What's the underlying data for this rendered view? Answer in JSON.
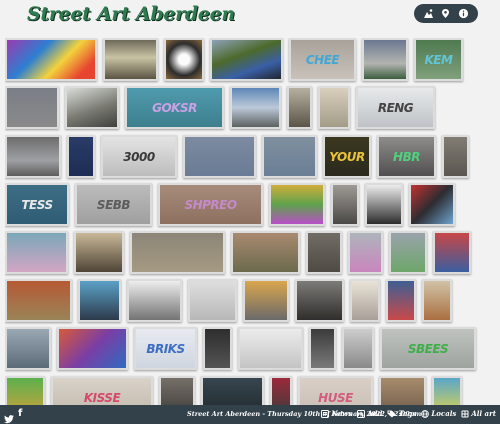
{
  "header": {
    "title": "Street Art Aberdeen"
  },
  "toolbar": [
    {
      "name": "gallery-view-icon",
      "label": ""
    },
    {
      "name": "map-pin-icon",
      "label": ""
    },
    {
      "name": "info-icon",
      "label": ""
    }
  ],
  "colors": {
    "title": "#2f7a4e",
    "bar": "#33414a",
    "background": "#f2f2f2"
  },
  "gallery": {
    "rows": [
      {
        "thumbs": [
          {
            "w": 92,
            "bg": "linear-gradient(135deg,#9c3bb0,#2d7fd1 35%,#f3d23d 60%,#e7452f 85%)",
            "text": "",
            "tc": "#fff"
          },
          {
            "w": 55,
            "bg": "linear-gradient(180deg,#6d6a5a,#c9c3a4 45%,#5b5443)",
            "text": "",
            "tc": "#fff"
          },
          {
            "w": 40,
            "bg": "radial-gradient(circle at 50% 50%,#fbfbfb 20%,#2c2c2c 60%,#8b6a3e)",
            "text": "",
            "tc": "#222"
          },
          {
            "w": 73,
            "bg": "linear-gradient(160deg,#8da3b8,#4d6a2c 40%,#3a5fa6 70%,#20262d)",
            "text": "",
            "tc": "#fff"
          },
          {
            "w": 67,
            "bg": "linear-gradient(180deg,#a8a29b,#c8c2ba)",
            "text": "CHEE",
            "tc": "#43a7d4"
          },
          {
            "w": 46,
            "bg": "linear-gradient(180deg,#6b7890,#b3b4b0 60%,#3c5f3f)",
            "text": "",
            "tc": "#fff"
          },
          {
            "w": 49,
            "bg": "linear-gradient(180deg,#4f7a50,#7fa07b)",
            "text": "KEM",
            "tc": "#62c5d5"
          }
        ]
      },
      {
        "thumbs": [
          {
            "w": 54,
            "bg": "linear-gradient(180deg,#7a7e86,#8a8a8a)",
            "text": "",
            "tc": "#78b6e6"
          },
          {
            "w": 54,
            "bg": "linear-gradient(160deg,#d9ddd8,#7b7b74 55%,#3f3f3d)",
            "text": "",
            "tc": "#fff"
          },
          {
            "w": 99,
            "bg": "linear-gradient(180deg,#4f9bae,#3d7f8e)",
            "text": "GOKSR",
            "tc": "#c8a2e4"
          },
          {
            "w": 51,
            "bg": "linear-gradient(180deg,#5d86b7,#bcc9d8 50%,#5d6161)",
            "text": "",
            "tc": "#fff"
          },
          {
            "w": 25,
            "bg": "linear-gradient(180deg,#b6b09f,#5b5549)",
            "text": "",
            "tc": "#fff"
          },
          {
            "w": 32,
            "bg": "linear-gradient(180deg,#d8d0bd,#a39c88)",
            "text": "",
            "tc": "#333"
          },
          {
            "w": 79,
            "bg": "linear-gradient(180deg,#e7e9ea,#bfc3c7)",
            "text": "RENG",
            "tc": "#444"
          }
        ]
      },
      {
        "thumbs": [
          {
            "w": 56,
            "bg": "linear-gradient(180deg,#6d6d6d,#9fa0a3 60%,#5d5d5d)",
            "text": "",
            "tc": "#fff"
          },
          {
            "w": 28,
            "bg": "linear-gradient(180deg,#293b67,#1d2d55)",
            "text": "",
            "tc": "#fff"
          },
          {
            "w": 76,
            "bg": "linear-gradient(180deg,#e4e4e4,#bdbdbd)",
            "text": "3000",
            "tc": "#3a3a3a"
          },
          {
            "w": 73,
            "bg": "linear-gradient(180deg,#7c8ba0,#6a7b95)",
            "text": "",
            "tc": "#e8a5d6"
          },
          {
            "w": 55,
            "bg": "linear-gradient(180deg,#7f8f9e,#6a7f95)",
            "text": "",
            "tc": "#fff"
          },
          {
            "w": 48,
            "bg": "linear-gradient(180deg,#3b3720,#2b2a1c)",
            "text": "YOUR",
            "tc": "#e7c33b"
          },
          {
            "w": 59,
            "bg": "linear-gradient(180deg,#8e8b8b,#514f4f)",
            "text": "HBR",
            "tc": "#4ed07d"
          },
          {
            "w": 27,
            "bg": "linear-gradient(180deg,#807c74,#5b5750)",
            "text": "",
            "tc": "#fff"
          }
        ]
      },
      {
        "thumbs": [
          {
            "w": 64,
            "bg": "linear-gradient(180deg,#3d6e86,#2e5c74)",
            "text": "TESS",
            "tc": "#e7e7e7"
          },
          {
            "w": 77,
            "bg": "linear-gradient(180deg,#bcbcbc,#9f9f9f)",
            "text": "SEBB",
            "tc": "#5d5d5d"
          },
          {
            "w": 105,
            "bg": "linear-gradient(180deg,#a78b7a,#8d7060)",
            "text": "SHPREO",
            "tc": "#c58ac9"
          },
          {
            "w": 56,
            "bg": "linear-gradient(180deg,#d0ad3b,#5ea24c 50%,#b84fc6)",
            "text": "",
            "tc": "#fff"
          },
          {
            "w": 28,
            "bg": "linear-gradient(180deg,#9e9a95,#4a4846)",
            "text": "",
            "tc": "#fff"
          },
          {
            "w": 38,
            "bg": "linear-gradient(180deg,#ededed,#2d2d2d)",
            "text": "",
            "tc": "#fff"
          },
          {
            "w": 46,
            "bg": "linear-gradient(135deg,#c4312e,#2d2d32 50%,#6fa3cf)",
            "text": "",
            "tc": "#fff"
          }
        ]
      },
      {
        "thumbs": [
          {
            "w": 63,
            "bg": "linear-gradient(180deg,#7ba7b8,#d2a6c4)",
            "text": "",
            "tc": "#fff"
          },
          {
            "w": 50,
            "bg": "linear-gradient(180deg,#c8b898,#4f4436)",
            "text": "",
            "tc": "#fff"
          },
          {
            "w": 95,
            "bg": "linear-gradient(180deg,#8c8578,#a59a82)",
            "text": "",
            "tc": "#fff"
          },
          {
            "w": 69,
            "bg": "linear-gradient(180deg,#aa8a70,#6b6a4d)",
            "text": "",
            "tc": "#fff"
          },
          {
            "w": 36,
            "bg": "linear-gradient(180deg,#716c65,#4f4a43)",
            "text": "",
            "tc": "#fff"
          },
          {
            "w": 35,
            "bg": "linear-gradient(180deg,#aeb4bb,#c986bd)",
            "text": "",
            "tc": "#fff"
          },
          {
            "w": 38,
            "bg": "linear-gradient(180deg,#9aa3ab,#6ea66a)",
            "text": "",
            "tc": "#fff"
          },
          {
            "w": 38,
            "bg": "linear-gradient(180deg,#c84747,#3a5ea0)",
            "text": "",
            "tc": "#fff"
          }
        ]
      },
      {
        "thumbs": [
          {
            "w": 67,
            "bg": "linear-gradient(180deg,#b65a34,#9a8357)",
            "text": "",
            "tc": "#fff"
          },
          {
            "w": 43,
            "bg": "linear-gradient(180deg,#5ba1c7,#2d3a4b)",
            "text": "",
            "tc": "#fff"
          },
          {
            "w": 55,
            "bg": "linear-gradient(180deg,#ededed,#737373)",
            "text": "",
            "tc": "#fff"
          },
          {
            "w": 49,
            "bg": "linear-gradient(180deg,#dedede,#b8b8b8)",
            "text": "",
            "tc": "#555"
          },
          {
            "w": 46,
            "bg": "linear-gradient(180deg,#d9a64d,#6a6a6a)",
            "text": "",
            "tc": "#fff"
          },
          {
            "w": 49,
            "bg": "linear-gradient(180deg,#7d7b77,#2f2e2c)",
            "text": "",
            "tc": "#fff"
          },
          {
            "w": 30,
            "bg": "linear-gradient(180deg,#e9e3d7,#a8a098)",
            "text": "",
            "tc": "#222"
          },
          {
            "w": 30,
            "bg": "linear-gradient(180deg,#3e5f93,#c94a4a)",
            "text": "",
            "tc": "#fff"
          },
          {
            "w": 30,
            "bg": "linear-gradient(180deg,#d1c2a6,#aa6f40)",
            "text": "",
            "tc": "#fff"
          }
        ]
      },
      {
        "thumbs": [
          {
            "w": 46,
            "bg": "linear-gradient(180deg,#9aa8b4,#5c6b78)",
            "text": "",
            "tc": "#fff"
          },
          {
            "w": 71,
            "bg": "linear-gradient(135deg,#d85a3a,#7a3ea5 50%,#2f6ac1)",
            "text": "",
            "tc": "#fff"
          },
          {
            "w": 63,
            "bg": "linear-gradient(180deg,#e7eaf0,#d0d6e0)",
            "text": "BRIKS",
            "tc": "#3d6fc3"
          },
          {
            "w": 29,
            "bg": "linear-gradient(180deg,#2e2e2e,#545454)",
            "text": "",
            "tc": "#fff"
          },
          {
            "w": 65,
            "bg": "linear-gradient(180deg,#ececec,#c4c4c4)",
            "text": "",
            "tc": "#222"
          },
          {
            "w": 27,
            "bg": "linear-gradient(180deg,#3b3b3b,#7a7a7a)",
            "text": "",
            "tc": "#fff"
          },
          {
            "w": 32,
            "bg": "linear-gradient(180deg,#cdcdcd,#8a8a8a)",
            "text": "",
            "tc": "#fff"
          },
          {
            "w": 96,
            "bg": "linear-gradient(180deg,#bfc3c0,#9ea39f)",
            "text": "SBEES",
            "tc": "#3fae4b"
          }
        ]
      },
      {
        "thumbs": [
          {
            "w": 40,
            "bg": "linear-gradient(180deg,#5bb04e,#d2a13b)",
            "text": "",
            "tc": "#fff"
          },
          {
            "w": 102,
            "bg": "linear-gradient(180deg,#d8d2c9,#c2b8ab)",
            "text": "KISSE",
            "tc": "#d44a6c"
          },
          {
            "w": 36,
            "bg": "linear-gradient(180deg,#76706a,#3d3a37)",
            "text": "",
            "tc": "#fff"
          },
          {
            "w": 63,
            "bg": "linear-gradient(180deg,#37464f,#20272c)",
            "text": "",
            "tc": "#fff"
          },
          {
            "w": 22,
            "bg": "linear-gradient(180deg,#9b2b3b,#3a3a3a)",
            "text": "",
            "tc": "#fff"
          },
          {
            "w": 75,
            "bg": "linear-gradient(180deg,#d9cfc7,#c9bdb3)",
            "text": "HUSE",
            "tc": "#d25c7d"
          },
          {
            "w": 47,
            "bg": "linear-gradient(180deg,#a88b6c,#6b5a4a)",
            "text": "",
            "tc": "#fff"
          },
          {
            "w": 30,
            "bg": "linear-gradient(180deg,#5aa6c9,#e2d64b)",
            "text": "",
            "tc": "#fff"
          }
        ]
      }
    ]
  },
  "footer": {
    "twitter_icon": "twitter-icon",
    "facebook_label": "f",
    "text": "Street Art Aberdeen - Thursday 10th of February 2022, 12:09pm",
    "links": [
      {
        "name": "news",
        "icon": "news-icon",
        "label": "News"
      },
      {
        "name": "add",
        "icon": "add-icon",
        "label": "Add"
      },
      {
        "name": "tags",
        "icon": "tags-icon",
        "label": "Tags"
      },
      {
        "name": "locals",
        "icon": "globe-icon",
        "label": "Locals"
      },
      {
        "name": "all-art",
        "icon": "all-art-icon",
        "label": "All art"
      }
    ]
  }
}
